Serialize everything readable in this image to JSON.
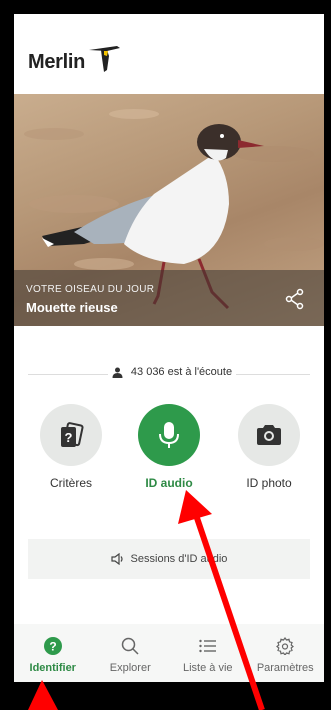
{
  "app": {
    "logo_text": "Merlin"
  },
  "bird_of_day": {
    "kicker": "VOTRE OISEAU DU JOUR",
    "name": "Mouette rieuse"
  },
  "listeners": {
    "text": "43 036 est à l'écoute"
  },
  "actions": [
    {
      "label": "Critères",
      "icon": "cards-question-icon",
      "active": false
    },
    {
      "label": "ID audio",
      "icon": "microphone-icon",
      "active": true
    },
    {
      "label": "ID photo",
      "icon": "camera-icon",
      "active": false
    }
  ],
  "sessions": {
    "label": "Sessions d'ID audio",
    "icon": "speaker-icon"
  },
  "bottom_nav": [
    {
      "label": "Identifier",
      "icon": "question-circle-icon",
      "active": true
    },
    {
      "label": "Explorer",
      "icon": "search-icon",
      "active": false
    },
    {
      "label": "Liste à vie",
      "icon": "list-icon",
      "active": false
    },
    {
      "label": "Paramètres",
      "icon": "gear-icon",
      "active": false
    }
  ],
  "colors": {
    "accent": "#2e9a4b",
    "annotation": "#ff0000"
  }
}
